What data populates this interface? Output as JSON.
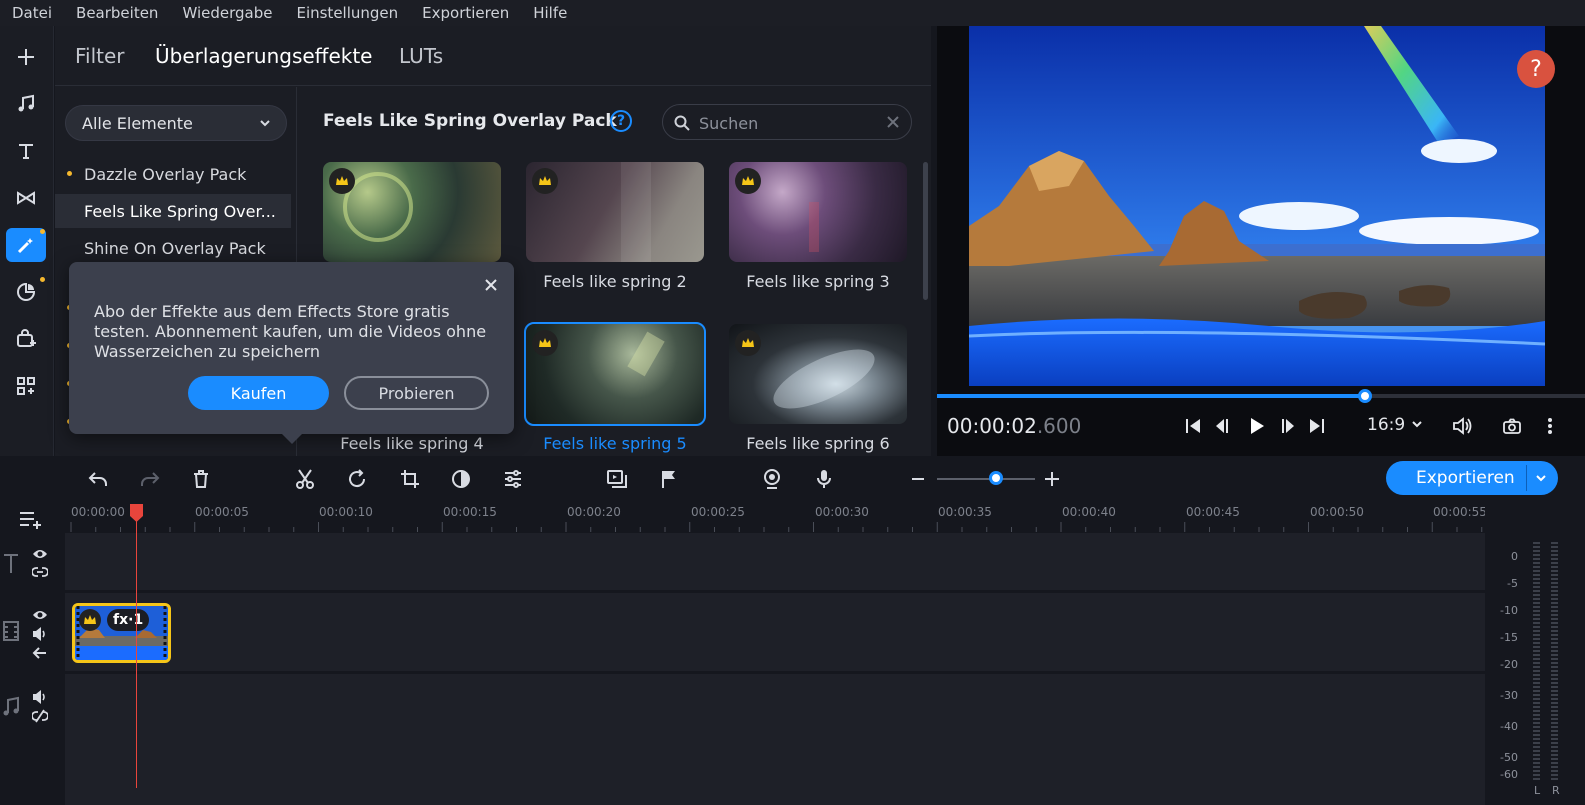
{
  "menu": [
    "Datei",
    "Bearbeiten",
    "Wiedergabe",
    "Einstellungen",
    "Exportieren",
    "Hilfe"
  ],
  "tabs": [
    "Filter",
    "Überlagerungseffekte",
    "LUTs"
  ],
  "category_dropdown": "Alle Elemente",
  "categories": [
    "Dazzle Overlay Pack",
    "Feels Like Spring Over...",
    "Shine On Overlay Pack"
  ],
  "pack_title": "Feels Like Spring Overlay Pack",
  "pack_help": "?",
  "search_placeholder": "Suchen",
  "thumbnails": [
    "Feels like spring 2",
    "Feels like spring 3",
    "Feels like spring 4",
    "Feels like spring 5",
    "Feels like spring 6"
  ],
  "popup": {
    "text": "Abo der Effekte aus dem Effects Store gratis testen. Abonnement kaufen, um die Videos ohne Wasserzeichen zu speichern",
    "buy": "Kaufen",
    "try": "Probieren"
  },
  "preview": {
    "help": "?",
    "timecode_main": "00:00:02",
    "timecode_ms": ".600",
    "aspect": "16:9",
    "progress": 0.66
  },
  "export_button": "Exportieren",
  "ruler": [
    "00:00:00",
    "00:00:05",
    "00:00:10",
    "00:00:15",
    "00:00:20",
    "00:00:25",
    "00:00:30",
    "00:00:35",
    "00:00:40",
    "00:00:45",
    "00:00:50",
    "00:00:55"
  ],
  "clip_badge": "fx·1",
  "meter_labels": [
    "0",
    "-5",
    "-10",
    "-15",
    "-20",
    "-30",
    "-40",
    "-50",
    "-60"
  ],
  "meter_channels": [
    "L",
    "R"
  ],
  "colors": {
    "accent": "#1a8cff",
    "crown": "#f5c518",
    "playhead": "#e8453c",
    "help": "#d9523f"
  }
}
